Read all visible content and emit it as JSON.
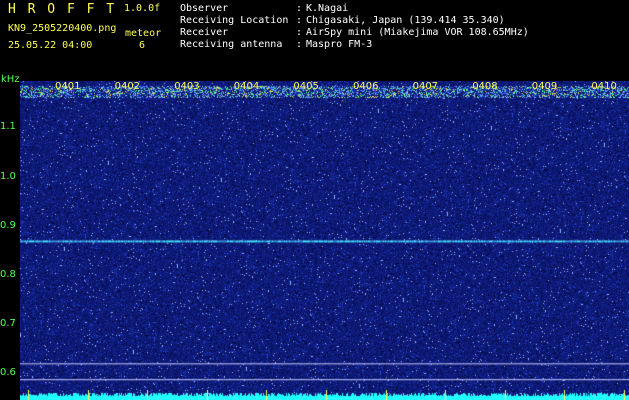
{
  "header": {
    "app_title": "H R O F F T",
    "version": "1.0.0f",
    "filename": "KN9_2505220400.png",
    "datetime": "25.05.22 04:00",
    "meteor_label": "meteor",
    "meteor_count": "6",
    "fields": [
      {
        "label": "Observer",
        "sep": ":",
        "value": "K.Nagai"
      },
      {
        "label": "Receiving Location",
        "sep": ":",
        "value": "Chigasaki, Japan (139.414 35.340)"
      },
      {
        "label": "Receiver",
        "sep": ":",
        "value": "AirSpy mini (Miakejima VOR 108.65MHz)"
      },
      {
        "label": "Receiving antenna",
        "sep": ":",
        "value": "Maspro FM-3"
      }
    ]
  },
  "spectrogram": {
    "y_unit": "kHz",
    "y_ticks": [
      "1.1",
      "1.0",
      "0.9",
      "0.8",
      "0.7",
      "0.6"
    ],
    "y_range_khz": [
      0.58,
      1.18
    ],
    "time_labels": [
      "0401",
      "0402",
      "0403",
      "0404",
      "0405",
      "0406",
      "0407",
      "0408",
      "0409",
      "0410"
    ],
    "carrier_khz": 0.87,
    "reference_lines_khz": [
      0.62,
      0.6
    ],
    "colors": {
      "background": "#0d1a78",
      "carrier": "#44e0ff",
      "axis_text": "#55ff55",
      "time_text": "#ffff55"
    }
  }
}
